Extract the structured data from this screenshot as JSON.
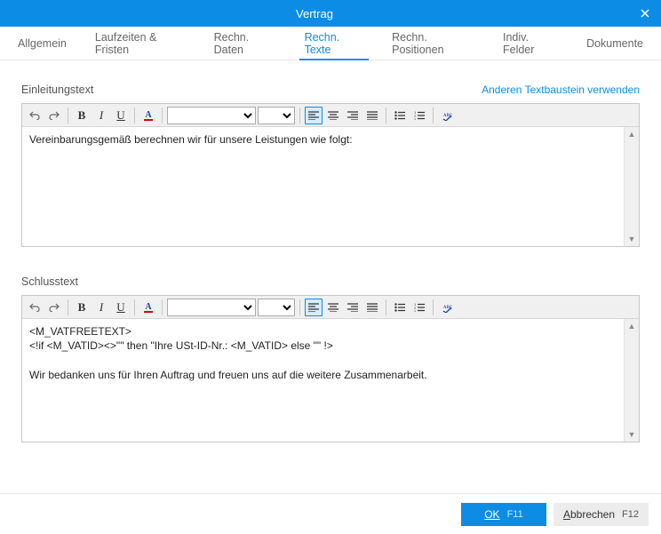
{
  "window": {
    "title": "Vertrag"
  },
  "tabs": [
    {
      "label": "Allgemein"
    },
    {
      "label": "Laufzeiten & Fristen"
    },
    {
      "label": "Rechn. Daten"
    },
    {
      "label": "Rechn. Texte",
      "active": true
    },
    {
      "label": "Rechn. Positionen"
    },
    {
      "label": "Indiv. Felder"
    },
    {
      "label": "Dokumente"
    }
  ],
  "intro": {
    "heading": "Einleitungstext",
    "link": "Anderen Textbaustein verwenden",
    "content": "Vereinbarungsgemäß berechnen wir für unsere Leistungen wie folgt:"
  },
  "closing": {
    "heading": "Schlusstext",
    "content": "<M_VATFREETEXT>\n<!if <M_VATID><>\"\" then \"Ihre USt-ID-Nr.: <M_VATID> else \"\" !>\n\nWir bedanken uns für Ihren Auftrag und freuen uns auf die weitere Zusammenarbeit."
  },
  "toolbar": {
    "font_value": "",
    "size_value": ""
  },
  "footer": {
    "ok": "OK",
    "ok_key": "F11",
    "cancel_prefix": "A",
    "cancel_rest": "bbrechen",
    "cancel_key": "F12"
  }
}
